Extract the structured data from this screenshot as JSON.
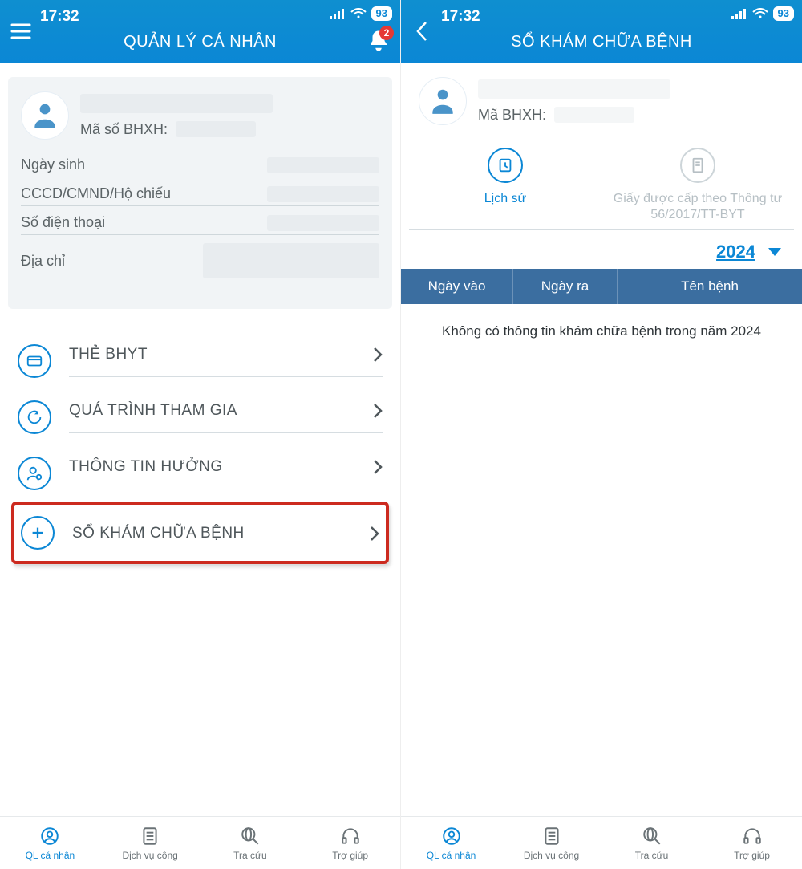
{
  "status": {
    "time": "17:32",
    "battery": "93"
  },
  "left": {
    "title": "QUẢN LÝ CÁ NHÂN",
    "bell_badge": "2",
    "profile": {
      "bhxh_label": "Mã số BHXH:",
      "rows": {
        "dob": "Ngày sinh",
        "id": "CCCD/CMND/Hộ chiếu",
        "phone": "Số điện thoại",
        "address": "Địa chỉ"
      }
    },
    "menu": {
      "bhyt": "THẺ BHYT",
      "process": "QUÁ TRÌNH THAM GIA",
      "benefit": "THÔNG TIN HƯỞNG",
      "medical": "SỔ KHÁM CHỮA BỆNH"
    }
  },
  "right": {
    "title": "SỔ KHÁM CHỮA BỆNH",
    "profile": {
      "bhxh_label": "Mã BHXH:"
    },
    "tabs": {
      "history": "Lịch sử",
      "cert": "Giấy được cấp theo Thông tư 56/2017/TT-BYT"
    },
    "year": "2024",
    "table": {
      "c1": "Ngày vào",
      "c2": "Ngày ra",
      "c3": "Tên bệnh"
    },
    "empty": "Không có thông tin khám chữa bệnh trong năm 2024"
  },
  "nav": {
    "personal": "QL cá nhân",
    "service": "Dịch vụ công",
    "lookup": "Tra cứu",
    "help": "Trợ giúp"
  }
}
